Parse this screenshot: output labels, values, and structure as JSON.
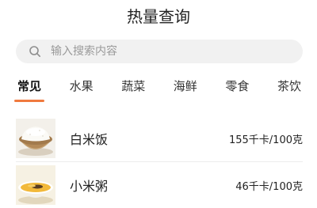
{
  "header": {
    "title": "热量查询"
  },
  "search": {
    "placeholder": "输入搜索内容",
    "icon": "search-icon"
  },
  "tabs": [
    {
      "label": "常见",
      "active": true
    },
    {
      "label": "水果",
      "active": false
    },
    {
      "label": "蔬菜",
      "active": false
    },
    {
      "label": "海鲜",
      "active": false
    },
    {
      "label": "零食",
      "active": false
    },
    {
      "label": "茶饮",
      "active": false
    }
  ],
  "foods": [
    {
      "name": "白米饭",
      "calories": "155千卡/100克",
      "image": "rice-bowl-image"
    },
    {
      "name": "小米粥",
      "calories": "46千卡/100克",
      "image": "millet-porridge-image"
    }
  ],
  "colors": {
    "accent": "#f07a3e",
    "search_bg": "#f1f1f1"
  }
}
